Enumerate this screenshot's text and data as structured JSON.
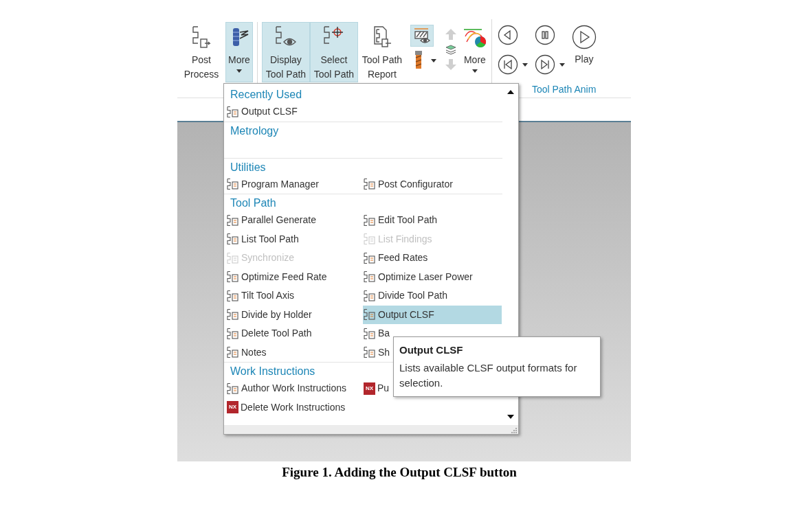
{
  "ribbon": {
    "groups": [
      {
        "items": [
          {
            "kind": "large",
            "label": "Post Process",
            "selected": false,
            "dropdown": false
          },
          {
            "kind": "large",
            "label": "More",
            "selected": true,
            "dropdown": true
          }
        ]
      },
      {
        "items": [
          {
            "kind": "large",
            "label": "Display Tool Path",
            "selected": true,
            "dropdown": false
          },
          {
            "kind": "large",
            "label": "Select Tool Path",
            "selected": true,
            "dropdown": false
          },
          {
            "kind": "large",
            "label": "Tool Path Report",
            "selected": false,
            "dropdown": false
          },
          {
            "kind": "pair",
            "selected": true,
            "dropdown": true
          },
          {
            "kind": "arrows",
            "disabled": true
          },
          {
            "kind": "large",
            "label": "More",
            "selected": false,
            "dropdown": true
          }
        ]
      }
    ],
    "animation": {
      "play_label": "Play",
      "group_label": "Tool Path Anim"
    }
  },
  "menu": {
    "sections": [
      {
        "title": "Recently Used",
        "items": [
          {
            "label": "Output CLSF",
            "disabled": false,
            "selected": false
          }
        ]
      },
      {
        "title": "Metrology"
      },
      {
        "title": "Utilities",
        "items": [
          {
            "label": "Program Manager",
            "disabled": false,
            "selected": false
          },
          {
            "label": "Post Configurator",
            "disabled": false,
            "selected": false
          }
        ]
      },
      {
        "title": "Tool Path",
        "items": [
          {
            "label": "Parallel Generate",
            "disabled": false,
            "selected": false
          },
          {
            "label": "Edit Tool Path",
            "disabled": false,
            "selected": false
          },
          {
            "label": "List Tool Path",
            "disabled": false,
            "selected": false
          },
          {
            "label": "List Findings",
            "disabled": true,
            "selected": false
          },
          {
            "label": "Synchronize",
            "disabled": true,
            "selected": false
          },
          {
            "label": "Feed Rates",
            "disabled": false,
            "selected": false
          },
          {
            "label": "Optimize Feed Rate",
            "disabled": false,
            "selected": false
          },
          {
            "label": "Optimize Laser Power",
            "disabled": false,
            "selected": false
          },
          {
            "label": "Tilt Tool Axis",
            "disabled": false,
            "selected": false
          },
          {
            "label": "Divide Tool Path",
            "disabled": false,
            "selected": false
          },
          {
            "label": "Divide by Holder",
            "disabled": false,
            "selected": false
          },
          {
            "label": "Output CLSF",
            "disabled": false,
            "selected": true
          },
          {
            "label": "Delete Tool Path",
            "disabled": false,
            "selected": false
          },
          {
            "label": "Ba",
            "disabled": false,
            "selected": false
          },
          {
            "label": "Notes",
            "disabled": false,
            "selected": false
          },
          {
            "label": "Sh",
            "disabled": false,
            "selected": false
          }
        ]
      },
      {
        "title": "Work Instructions",
        "items": [
          {
            "label": "Author Work Instructions",
            "disabled": false,
            "selected": false
          },
          {
            "label": "Pu",
            "disabled": false,
            "selected": false,
            "badge": "NX"
          },
          {
            "label": "Delete Work Instructions",
            "disabled": false,
            "selected": false,
            "badge": "NX"
          }
        ]
      }
    ]
  },
  "tooltip": {
    "title": "Output CLSF",
    "text": "Lists available CLSF output formats for selection."
  },
  "caption": "Figure 1. Adding the Output CLSF button"
}
